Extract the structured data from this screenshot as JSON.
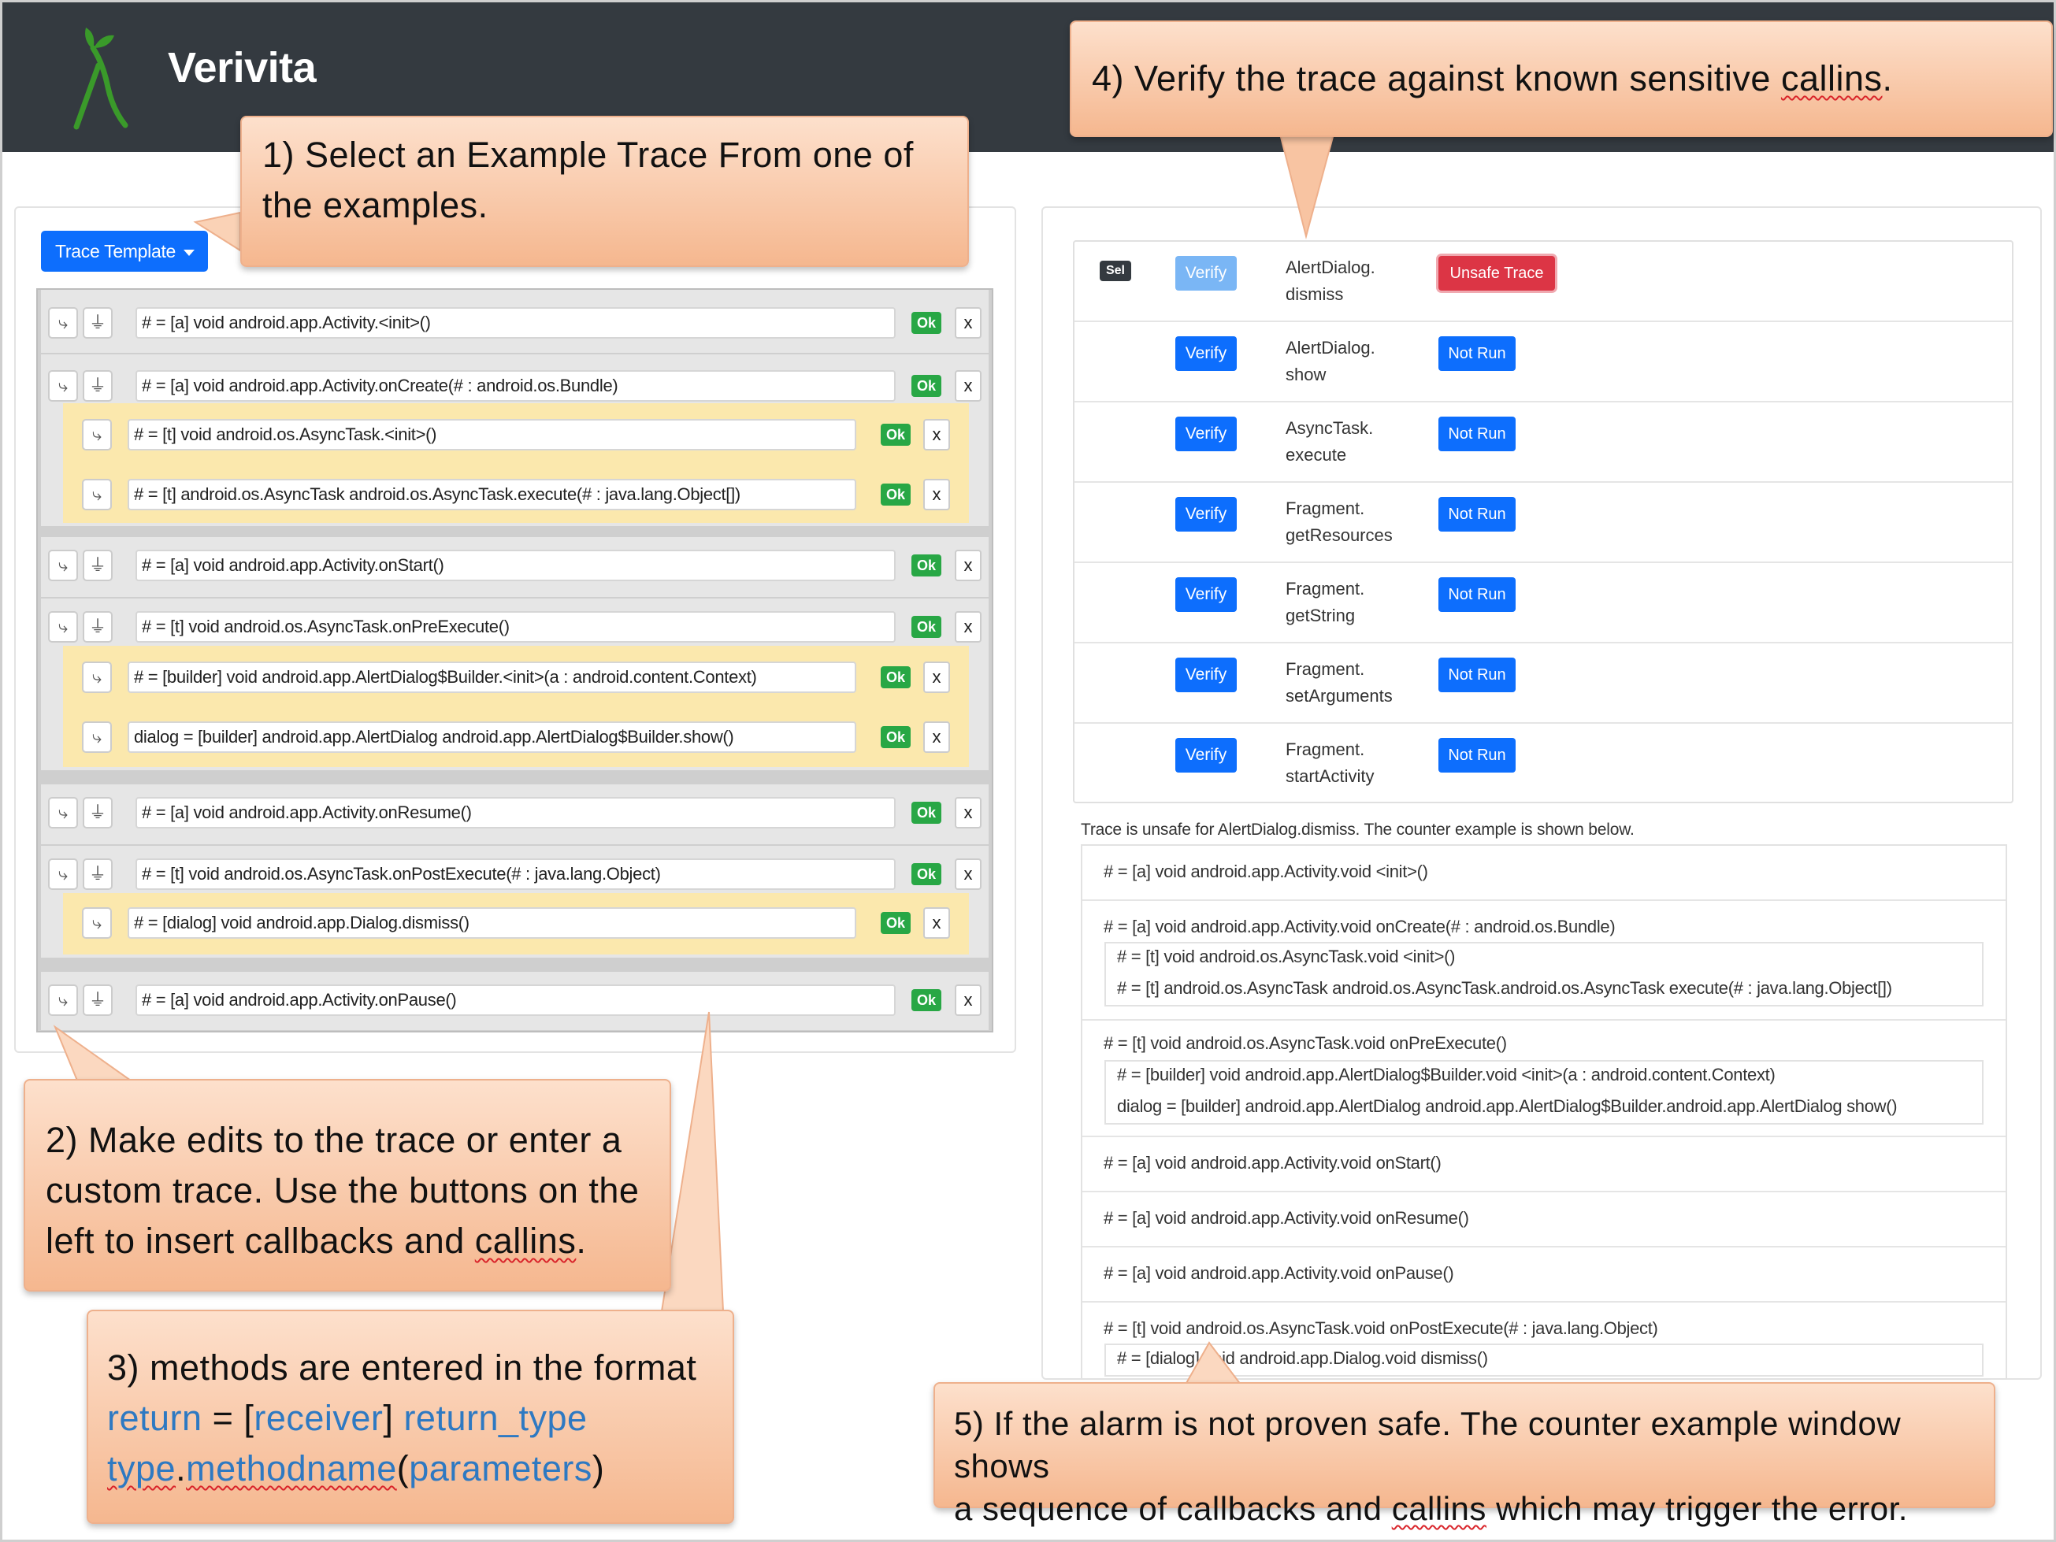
{
  "header": {
    "brand": "Verivita"
  },
  "template_button": {
    "label": "Trace Template"
  },
  "trace": {
    "rows": [
      {
        "kind": "callback",
        "text": "# = [a] void android.app.Activity.<init>()",
        "ok": "Ok",
        "remove": "x"
      },
      {
        "kind": "callback",
        "text": "# = [a] void android.app.Activity.onCreate(# : android.os.Bundle)",
        "ok": "Ok",
        "remove": "x"
      },
      {
        "kind": "callin",
        "text": "# = [t] void android.os.AsyncTask.<init>()",
        "ok": "Ok",
        "remove": "x"
      },
      {
        "kind": "callin",
        "text": "# = [t] android.os.AsyncTask android.os.AsyncTask.execute(# : java.lang.Object[])",
        "ok": "Ok",
        "remove": "x"
      },
      {
        "kind": "callback",
        "text": "# = [a] void android.app.Activity.onStart()",
        "ok": "Ok",
        "remove": "x"
      },
      {
        "kind": "callback",
        "text": "# = [t] void android.os.AsyncTask.onPreExecute()",
        "ok": "Ok",
        "remove": "x"
      },
      {
        "kind": "callin",
        "text": "# = [builder] void android.app.AlertDialog$Builder.<init>(a : android.content.Context)",
        "ok": "Ok",
        "remove": "x"
      },
      {
        "kind": "callin",
        "text": "dialog = [builder] android.app.AlertDialog android.app.AlertDialog$Builder.show()",
        "ok": "Ok",
        "remove": "x"
      },
      {
        "kind": "callback",
        "text": "# = [a] void android.app.Activity.onResume()",
        "ok": "Ok",
        "remove": "x"
      },
      {
        "kind": "callback",
        "text": "# = [t] void android.os.AsyncTask.onPostExecute(# : java.lang.Object)",
        "ok": "Ok",
        "remove": "x"
      },
      {
        "kind": "callin",
        "text": "# = [dialog] void android.app.Dialog.dismiss()",
        "ok": "Ok",
        "remove": "x"
      },
      {
        "kind": "callback",
        "text": "# = [a] void android.app.Activity.onPause()",
        "ok": "Ok",
        "remove": "x"
      }
    ]
  },
  "verify": {
    "rows": [
      {
        "sel": "Sel",
        "button": "Verify",
        "name1": "AlertDialog.",
        "name2": "dismiss",
        "status": "Unsafe Trace"
      },
      {
        "sel": "",
        "button": "Verify",
        "name1": "AlertDialog.",
        "name2": "show",
        "status": "Not Run"
      },
      {
        "sel": "",
        "button": "Verify",
        "name1": "AsyncTask.",
        "name2": "execute",
        "status": "Not Run"
      },
      {
        "sel": "",
        "button": "Verify",
        "name1": "Fragment.",
        "name2": "getResources",
        "status": "Not Run"
      },
      {
        "sel": "",
        "button": "Verify",
        "name1": "Fragment.",
        "name2": "getString",
        "status": "Not Run"
      },
      {
        "sel": "",
        "button": "Verify",
        "name1": "Fragment.",
        "name2": "setArguments",
        "status": "Not Run"
      },
      {
        "sel": "",
        "button": "Verify",
        "name1": "Fragment.",
        "name2": "startActivity",
        "status": "Not Run"
      }
    ]
  },
  "counter_example": {
    "message": "Trace is unsafe for AlertDialog.dismiss. The counter example is shown below.",
    "items": [
      {
        "line": "# = [a] void android.app.Activity.void <init>()",
        "subs": []
      },
      {
        "line": "# = [a] void android.app.Activity.void onCreate(# : android.os.Bundle)",
        "subs": [
          "# = [t] void android.os.AsyncTask.void <init>()",
          "# = [t] android.os.AsyncTask android.os.AsyncTask.android.os.AsyncTask execute(# : java.lang.Object[])"
        ]
      },
      {
        "line": "# = [t] void android.os.AsyncTask.void onPreExecute()",
        "subs": [
          "# = [builder] void android.app.AlertDialog$Builder.void <init>(a : android.content.Context)",
          "dialog = [builder] android.app.AlertDialog android.app.AlertDialog$Builder.android.app.AlertDialog show()"
        ]
      },
      {
        "line": "# = [a] void android.app.Activity.void onStart()",
        "subs": []
      },
      {
        "line": "# = [a] void android.app.Activity.void onResume()",
        "subs": []
      },
      {
        "line": "# = [a] void android.app.Activity.void onPause()",
        "subs": []
      },
      {
        "line": "# = [t] void android.os.AsyncTask.void onPostExecute(# : java.lang.Object)",
        "subs": [
          "# = [dialog] void android.app.Dialog.void dismiss()"
        ]
      }
    ]
  },
  "callouts": {
    "c1": {
      "line1": "1) Select an Example Trace From one of",
      "line2": "the examples."
    },
    "c2": {
      "line1": "2) Make edits to the trace or enter a",
      "line2": "custom trace. Use the buttons on the",
      "line3a": "left to insert callbacks and ",
      "line3b": "callins",
      "line3c": "."
    },
    "c3": {
      "line1": "3) methods are entered in the format",
      "w_return": "return",
      "eq": " = [",
      "w_receiver": "receiver",
      "close": "] ",
      "w_return_type": "return_type",
      "w_type": "type",
      "dot": ".",
      "w_methodname": "methodname",
      "open_paren": "(",
      "w_parameters": "parameters",
      "close_paren": ")"
    },
    "c4": {
      "text_a": "4) Verify the trace against known sensitive ",
      "text_b": "callins",
      "text_c": "."
    },
    "c5": {
      "line1": "5) If the alarm is not proven safe. The counter example window shows",
      "line2a": "a sequence of callbacks and ",
      "line2b": "callins",
      "line2c": " which may trigger the error."
    }
  },
  "colors": {
    "navbar": "#343a40",
    "primary": "#0d6efd",
    "danger": "#dc3545",
    "ok": "#28a745",
    "callin_bg": "#fbe8ad",
    "callout": "#f5b78f",
    "format_token": "#2e79c2"
  }
}
